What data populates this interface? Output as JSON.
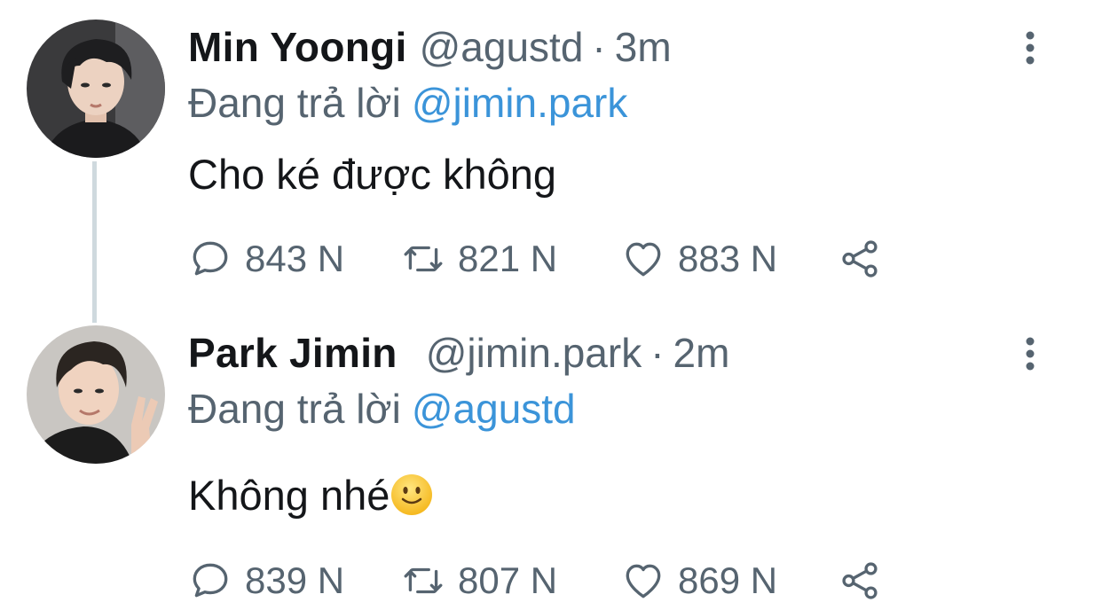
{
  "tweets": [
    {
      "author_name": "Min Yoongi",
      "handle": "@agustd",
      "separator": "·",
      "time": "3m",
      "replying_prefix": "Đang trả lời",
      "replying_to": "@jimin.park",
      "text": "Cho ké được không",
      "stats": {
        "replies": "843 N",
        "retweets": "821 N",
        "likes": "883 N"
      },
      "avatar_icon": "avatar-photo-icon"
    },
    {
      "author_name": "Park Jimin",
      "handle": "@jimin.park",
      "separator": "·",
      "time": "2m",
      "replying_prefix": "Đang trả lời",
      "replying_to": "@agustd",
      "text": "Không nhé",
      "emoji": "slightly-smiling-face-emoji",
      "stats": {
        "replies": "839 N",
        "retweets": "807 N",
        "likes": "869 N"
      },
      "avatar_icon": "avatar-photo-icon"
    }
  ],
  "colors": {
    "text": "#141619",
    "secondary": "#566470",
    "mention": "#3b94d9",
    "thread_line": "#cfd9de"
  },
  "icons": [
    "reply-icon",
    "retweet-icon",
    "like-icon",
    "share-icon",
    "more-options-icon"
  ]
}
